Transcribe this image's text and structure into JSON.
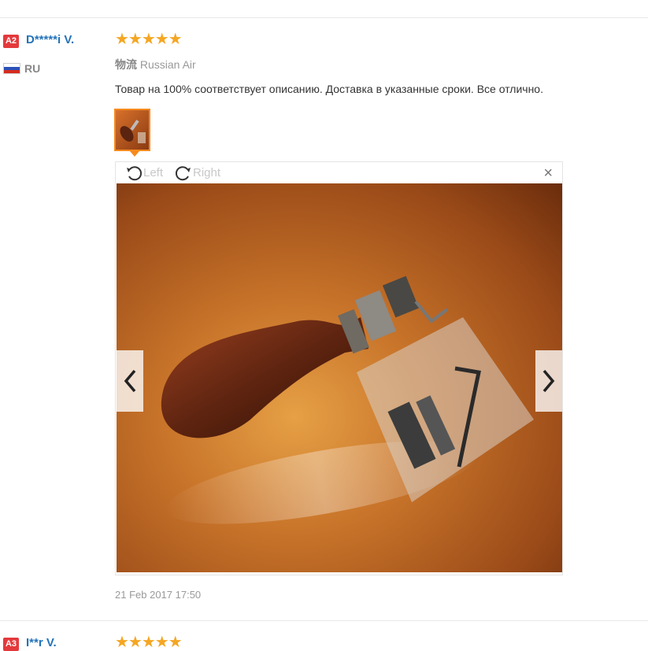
{
  "reviews": [
    {
      "badge": "A2",
      "user": "D*****i V.",
      "country": "RU",
      "stars": "★★★★★",
      "shipping_label": "物流",
      "shipping_method": "Russian Air",
      "text": "Товар на 100% соответствует описанию. Доставка в указанные сроки. Все отлично.",
      "timestamp": "21 Feb 2017 17:50",
      "viewer": {
        "rotate_left": "Left",
        "rotate_right": "Right",
        "close": "×"
      }
    },
    {
      "badge": "A3",
      "user": "I**r V.",
      "stars": "★★★★★"
    }
  ],
  "colors": {
    "badge": "#e4393c",
    "username": "#2273b8",
    "stars": "#f5a623",
    "thumb_border": "#f68a1e"
  },
  "icons": [
    "rotate-left-icon",
    "rotate-right-icon",
    "close-icon",
    "chevron-left-icon",
    "chevron-right-icon",
    "flag-ru-icon"
  ]
}
